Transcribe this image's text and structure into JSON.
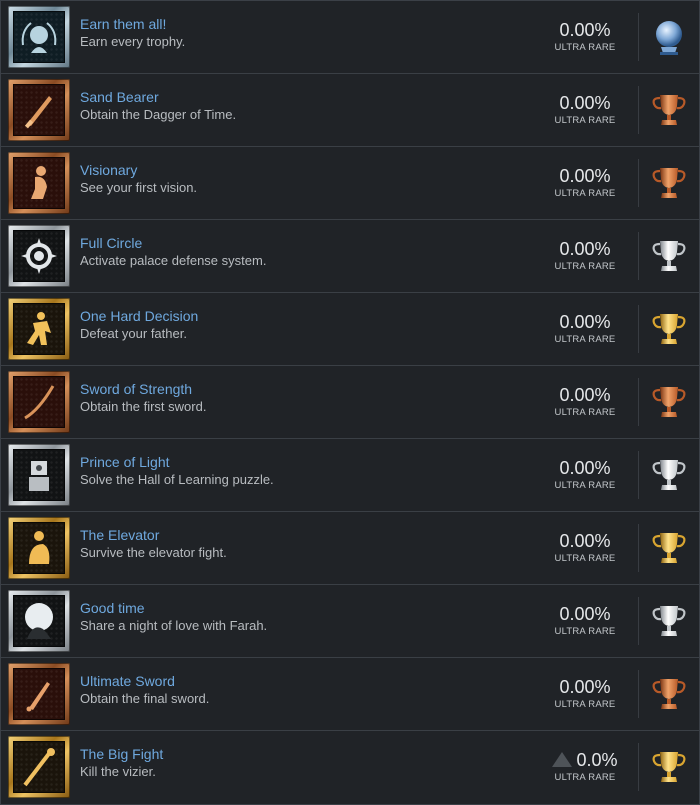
{
  "colors": {
    "background": "#202327",
    "title": "#6fa9df",
    "bronze": "#c46a37",
    "silver": "#c7ccd0",
    "gold": "#d9a530",
    "platinum": "#6fa3d9"
  },
  "trophies": [
    {
      "title": "Earn them all!",
      "desc": "Earn every trophy.",
      "percent": "0.00%",
      "rarity": "ULTRA RARE",
      "grade": "platinum",
      "icon": "laurel-portrait-icon"
    },
    {
      "title": "Sand Bearer",
      "desc": "Obtain the Dagger of Time.",
      "percent": "0.00%",
      "rarity": "ULTRA RARE",
      "grade": "bronze",
      "icon": "dagger-icon"
    },
    {
      "title": "Visionary",
      "desc": "See your first vision.",
      "percent": "0.00%",
      "rarity": "ULTRA RARE",
      "grade": "bronze",
      "icon": "kneeling-figure-icon"
    },
    {
      "title": "Full Circle",
      "desc": "Activate palace defense system.",
      "percent": "0.00%",
      "rarity": "ULTRA RARE",
      "grade": "silver",
      "icon": "spiked-ring-icon"
    },
    {
      "title": "One Hard Decision",
      "desc": "Defeat your father.",
      "percent": "0.00%",
      "rarity": "ULTRA RARE",
      "grade": "gold",
      "icon": "fighter-icon"
    },
    {
      "title": "Sword of Strength",
      "desc": "Obtain the first sword.",
      "percent": "0.00%",
      "rarity": "ULTRA RARE",
      "grade": "bronze",
      "icon": "curved-sword-icon"
    },
    {
      "title": "Prince of Light",
      "desc": "Solve the Hall of Learning puzzle.",
      "percent": "0.00%",
      "rarity": "ULTRA RARE",
      "grade": "silver",
      "icon": "statue-icon"
    },
    {
      "title": "The Elevator",
      "desc": "Survive the elevator fight.",
      "percent": "0.00%",
      "rarity": "ULTRA RARE",
      "grade": "gold",
      "icon": "crouching-warrior-icon"
    },
    {
      "title": "Good time",
      "desc": "Share a night of love with Farah.",
      "percent": "0.00%",
      "rarity": "ULTRA RARE",
      "grade": "silver",
      "icon": "moonlit-couple-icon"
    },
    {
      "title": "Ultimate Sword",
      "desc": "Obtain the final sword.",
      "percent": "0.00%",
      "rarity": "ULTRA RARE",
      "grade": "bronze",
      "icon": "short-sword-icon"
    },
    {
      "title": "The Big Fight",
      "desc": "Kill the vizier.",
      "percent": "0.0%",
      "rarity": "ULTRA RARE",
      "grade": "gold",
      "icon": "staff-icon",
      "trend": "triangle-icon"
    }
  ]
}
